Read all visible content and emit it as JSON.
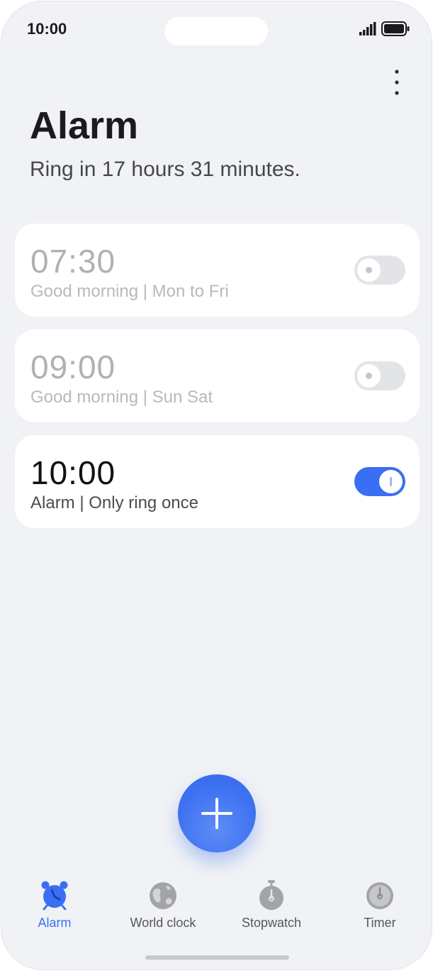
{
  "status_bar": {
    "time": "10:00"
  },
  "header": {
    "title": "Alarm",
    "subtitle": "Ring in 17 hours 31 minutes."
  },
  "alarms": [
    {
      "time": "07:30",
      "description": "Good morning | Mon to Fri",
      "enabled": false
    },
    {
      "time": "09:00",
      "description": "Good morning | Sun Sat",
      "enabled": false
    },
    {
      "time": "10:00",
      "description": "Alarm | Only ring once",
      "enabled": true
    }
  ],
  "nav": {
    "items": [
      {
        "label": "Alarm",
        "icon": "alarm-clock-icon",
        "active": true
      },
      {
        "label": "World clock",
        "icon": "globe-icon",
        "active": false
      },
      {
        "label": "Stopwatch",
        "icon": "stopwatch-icon",
        "active": false
      },
      {
        "label": "Timer",
        "icon": "timer-icon",
        "active": false
      }
    ]
  },
  "colors": {
    "accent": "#3a6ff3",
    "background": "#f1f2f5",
    "card": "#ffffff",
    "inactive_text": "#b0b1b5"
  }
}
